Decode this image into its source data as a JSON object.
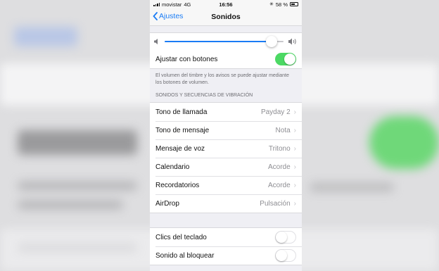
{
  "status": {
    "carrier": "movistar",
    "network": "4G",
    "time": "16:56",
    "battery": "58 %"
  },
  "nav": {
    "back_label": "Ajustes",
    "title": "Sonidos"
  },
  "volume": {
    "level": 0.9,
    "row_label": "Ajustar con botones",
    "toggle_on": true
  },
  "volume_note": "El volumen del timbre y los avisos se puede ajustar mediante los botones de volumen.",
  "section_header": "SONIDOS Y SECUENCIAS DE VIBRACIÓN",
  "sounds": [
    {
      "label": "Tono de llamada",
      "value": "Payday 2"
    },
    {
      "label": "Tono de mensaje",
      "value": "Nota"
    },
    {
      "label": "Mensaje de voz",
      "value": "Tritono"
    },
    {
      "label": "Calendario",
      "value": "Acorde"
    },
    {
      "label": "Recordatorios",
      "value": "Acorde"
    },
    {
      "label": "AirDrop",
      "value": "Pulsación"
    }
  ],
  "toggles": [
    {
      "label": "Clics del teclado",
      "on": false
    },
    {
      "label": "Sonido al bloquear",
      "on": false
    }
  ],
  "colors": {
    "accent": "#1a7cf5",
    "switch_on": "#4cd964",
    "background": "#efeff4"
  }
}
